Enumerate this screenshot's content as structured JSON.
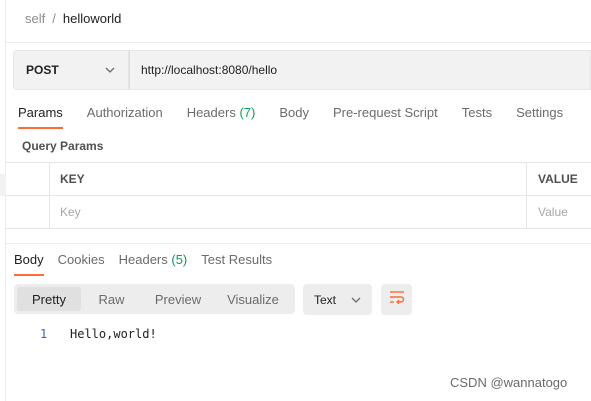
{
  "breadcrumb": {
    "parent": "self",
    "separator": "/",
    "current": "helloworld"
  },
  "request": {
    "method": "POST",
    "url": "http://localhost:8080/hello",
    "tabs": [
      {
        "label": "Params",
        "count": ""
      },
      {
        "label": "Authorization",
        "count": ""
      },
      {
        "label": "Headers",
        "count": "(7)"
      },
      {
        "label": "Body",
        "count": ""
      },
      {
        "label": "Pre-request Script",
        "count": ""
      },
      {
        "label": "Tests",
        "count": ""
      },
      {
        "label": "Settings",
        "count": ""
      }
    ],
    "active_tab": "Params"
  },
  "query_params": {
    "title": "Query Params",
    "columns": [
      "KEY",
      "VALUE"
    ],
    "placeholder_row": {
      "key": "Key",
      "value": "Value"
    }
  },
  "response": {
    "tabs": [
      {
        "label": "Body",
        "count": ""
      },
      {
        "label": "Cookies",
        "count": ""
      },
      {
        "label": "Headers",
        "count": "(5)"
      },
      {
        "label": "Test Results",
        "count": ""
      }
    ],
    "active_tab": "Body",
    "view_modes": [
      "Pretty",
      "Raw",
      "Preview",
      "Visualize"
    ],
    "active_view": "Pretty",
    "format": "Text",
    "lines": [
      {
        "number": "1",
        "text": "Hello,world!"
      }
    ]
  },
  "watermark": "CSDN @wannatogo",
  "colors": {
    "accent": "#ff6c37",
    "count_green": "#0c9d58",
    "line_number": "#2a6ebf"
  },
  "icons": {
    "method_dropdown": "chevron-down-icon",
    "format_dropdown": "chevron-down-icon",
    "wrap": "wrap-lines-icon"
  }
}
